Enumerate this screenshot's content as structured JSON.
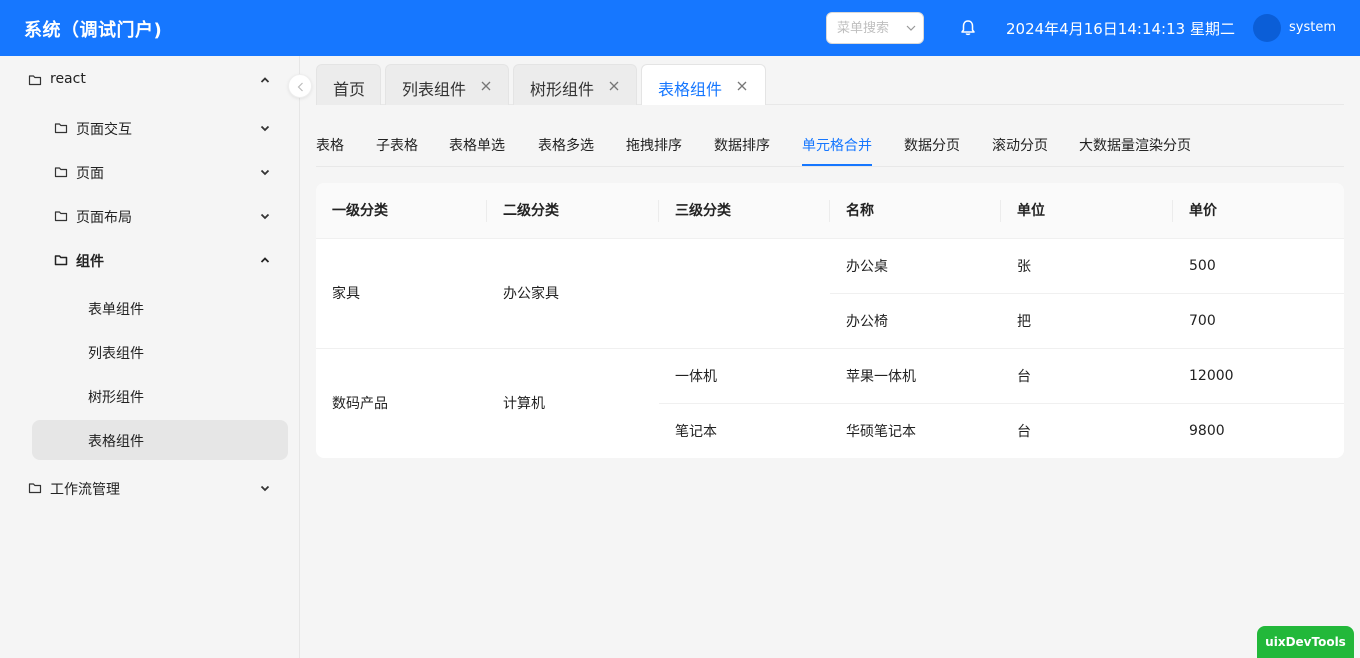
{
  "header": {
    "app_title": "系统（调试门户)",
    "menu_search_placeholder": "菜单搜索",
    "datetime": "2024年4月16日14:14:13 星期二",
    "username": "system"
  },
  "sidebar": {
    "items": [
      {
        "label": "react",
        "expanded": true
      },
      {
        "label": "页面交互",
        "expanded": false
      },
      {
        "label": "页面",
        "expanded": false
      },
      {
        "label": "页面布局",
        "expanded": false
      },
      {
        "label": "组件",
        "expanded": true
      },
      {
        "label": "表单组件"
      },
      {
        "label": "列表组件"
      },
      {
        "label": "树形组件"
      },
      {
        "label": "表格组件",
        "active": true
      },
      {
        "label": "工作流管理",
        "expanded": false
      }
    ]
  },
  "page_tabs": [
    {
      "label": "首页",
      "closable": false
    },
    {
      "label": "列表组件",
      "closable": true
    },
    {
      "label": "树形组件",
      "closable": true
    },
    {
      "label": "表格组件",
      "closable": true,
      "active": true
    }
  ],
  "sub_tabs": [
    {
      "label": "表格"
    },
    {
      "label": "子表格"
    },
    {
      "label": "表格单选"
    },
    {
      "label": "表格多选"
    },
    {
      "label": "拖拽排序"
    },
    {
      "label": "数据排序"
    },
    {
      "label": "单元格合并",
      "active": true
    },
    {
      "label": "数据分页"
    },
    {
      "label": "滚动分页"
    },
    {
      "label": "大数据量渲染分页"
    }
  ],
  "table": {
    "columns": [
      "一级分类",
      "二级分类",
      "三级分类",
      "名称",
      "单位",
      "单价"
    ],
    "rows": [
      {
        "level1": "家具",
        "level2": "办公家具",
        "level3": "",
        "name": "办公桌",
        "unit": "张",
        "price": "500"
      },
      {
        "level1": "",
        "level2": "",
        "level3": "",
        "name": "办公椅",
        "unit": "把",
        "price": "700"
      },
      {
        "level1": "数码产品",
        "level2": "计算机",
        "level3": "一体机",
        "name": "苹果一体机",
        "unit": "台",
        "price": "12000"
      },
      {
        "level1": "",
        "level2": "",
        "level3": "笔记本",
        "name": "华硕笔记本",
        "unit": "台",
        "price": "9800"
      }
    ]
  },
  "devtools_label": "uixDevTools",
  "colors": {
    "primary": "#1677ff",
    "header_bg": "#1677ff",
    "sidebar_bg": "#f5f5f5",
    "active_menu_bg": "#e6e6e6",
    "devtools_bg": "#22b83a"
  },
  "icons": {
    "folder": "folder-icon",
    "chevron_up": "chevron-up-icon",
    "chevron_down": "chevron-down-icon",
    "close": "close-icon",
    "bell": "bell-icon",
    "collapse": "chevron-left-icon"
  }
}
